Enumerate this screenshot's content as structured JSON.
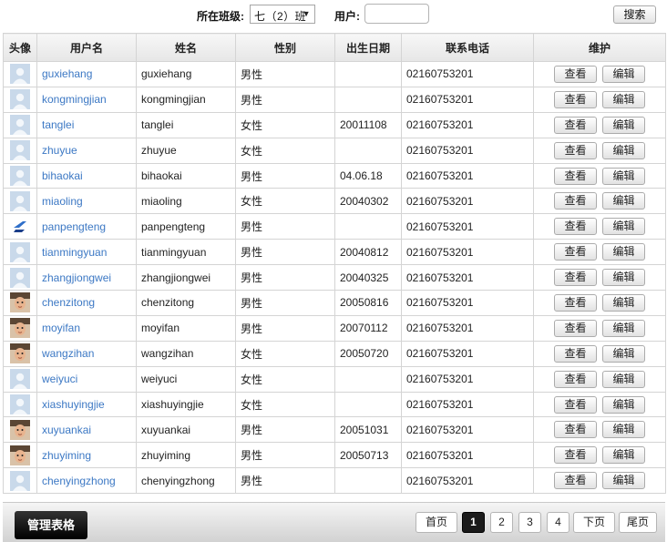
{
  "filter": {
    "class_label": "所在班级:",
    "class_value": "七（2）班",
    "user_label": "用户:",
    "user_value": "",
    "search_label": "搜索"
  },
  "table": {
    "headers": [
      "头像",
      "用户名",
      "姓名",
      "性别",
      "出生日期",
      "联系电话",
      "维护"
    ],
    "view_label": "查看",
    "edit_label": "编辑",
    "rows": [
      {
        "avatar": "default-avatar",
        "username": "guxiehang",
        "name": "guxiehang",
        "gender": "男性",
        "birth": "",
        "phone": "02160753201"
      },
      {
        "avatar": "default-avatar",
        "username": "kongmingjian",
        "name": "kongmingjian",
        "gender": "男性",
        "birth": "",
        "phone": "02160753201"
      },
      {
        "avatar": "default-avatar",
        "username": "tanglei",
        "name": "tanglei",
        "gender": "女性",
        "birth": "20011108",
        "phone": "02160753201"
      },
      {
        "avatar": "default-avatar",
        "username": "zhuyue",
        "name": "zhuyue",
        "gender": "女性",
        "birth": "",
        "phone": "02160753201"
      },
      {
        "avatar": "default-avatar",
        "username": "bihaokai",
        "name": "bihaokai",
        "gender": "男性",
        "birth": "04.06.18",
        "phone": "02160753201"
      },
      {
        "avatar": "default-avatar",
        "username": "miaoling",
        "name": "miaoling",
        "gender": "女性",
        "birth": "20040302",
        "phone": "02160753201"
      },
      {
        "avatar": "logo-avatar",
        "username": "panpengteng",
        "name": "panpengteng",
        "gender": "男性",
        "birth": "",
        "phone": "02160753201"
      },
      {
        "avatar": "default-avatar",
        "username": "tianmingyuan",
        "name": "tianmingyuan",
        "gender": "男性",
        "birth": "20040812",
        "phone": "02160753201"
      },
      {
        "avatar": "default-avatar",
        "username": "zhangjiongwei",
        "name": "zhangjiongwei",
        "gender": "男性",
        "birth": "20040325",
        "phone": "02160753201"
      },
      {
        "avatar": "photo-avatar",
        "username": "chenzitong",
        "name": "chenzitong",
        "gender": "男性",
        "birth": "20050816",
        "phone": "02160753201"
      },
      {
        "avatar": "photo-avatar",
        "username": "moyifan",
        "name": "moyifan",
        "gender": "男性",
        "birth": "20070112",
        "phone": "02160753201"
      },
      {
        "avatar": "photo-avatar",
        "username": "wangzihan",
        "name": "wangzihan",
        "gender": "女性",
        "birth": "20050720",
        "phone": "02160753201"
      },
      {
        "avatar": "default-avatar",
        "username": "weiyuci",
        "name": "weiyuci",
        "gender": "女性",
        "birth": "",
        "phone": "02160753201"
      },
      {
        "avatar": "default-avatar",
        "username": "xiashuyingjie",
        "name": "xiashuyingjie",
        "gender": "女性",
        "birth": "",
        "phone": "02160753201"
      },
      {
        "avatar": "photo-avatar",
        "username": "xuyuankai",
        "name": "xuyuankai",
        "gender": "男性",
        "birth": "20051031",
        "phone": "02160753201"
      },
      {
        "avatar": "photo-avatar",
        "username": "zhuyiming",
        "name": "zhuyiming",
        "gender": "男性",
        "birth": "20050713",
        "phone": "02160753201"
      },
      {
        "avatar": "default-avatar",
        "username": "chenyingzhong",
        "name": "chenyingzhong",
        "gender": "男性",
        "birth": "",
        "phone": "02160753201"
      }
    ]
  },
  "footer": {
    "manage_label": "管理表格",
    "pager": {
      "first": "首页",
      "pages": [
        "1",
        "2",
        "3",
        "4"
      ],
      "current": "1",
      "next": "下页",
      "last": "尾页"
    }
  },
  "colors": {
    "link": "#3c78c4",
    "active_page": "#1a1a1a"
  }
}
